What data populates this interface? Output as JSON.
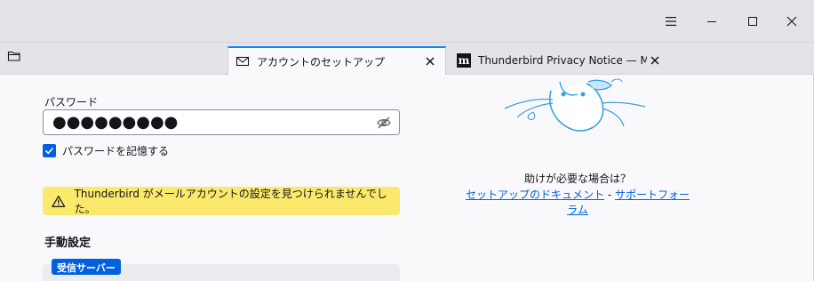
{
  "window": {
    "controls": {
      "menu_icon": "hamburger-icon",
      "minimize_icon": "minimize-icon",
      "maximize_icon": "maximize-icon",
      "close_icon": "close-icon"
    }
  },
  "tabs": [
    {
      "label": "アカウントのセットアップ",
      "icon": "mail-icon",
      "active": true
    },
    {
      "label": "Thunderbird Privacy Notice — Mozi",
      "icon": "mozilla-m-icon",
      "active": false
    }
  ],
  "form": {
    "password_label": "パスワード",
    "password_value": "●●●●●●●●●",
    "remember_label": "パスワードを記憶する",
    "remember_checked": true,
    "warning_text": "Thunderbird がメールアカウントの設定を見つけられませんでした。",
    "manual_heading": "手動設定",
    "incoming_badge": "受信サーバー"
  },
  "help": {
    "question": "助けが必要な場合は？",
    "link_docs": "セットアップのドキュメント",
    "separator": " - ",
    "link_forum": "サポートフォーラム"
  },
  "colors": {
    "accent": "#0061e0",
    "tab_indicator": "#0a84ff",
    "warning_bg": "#fbe96b"
  }
}
